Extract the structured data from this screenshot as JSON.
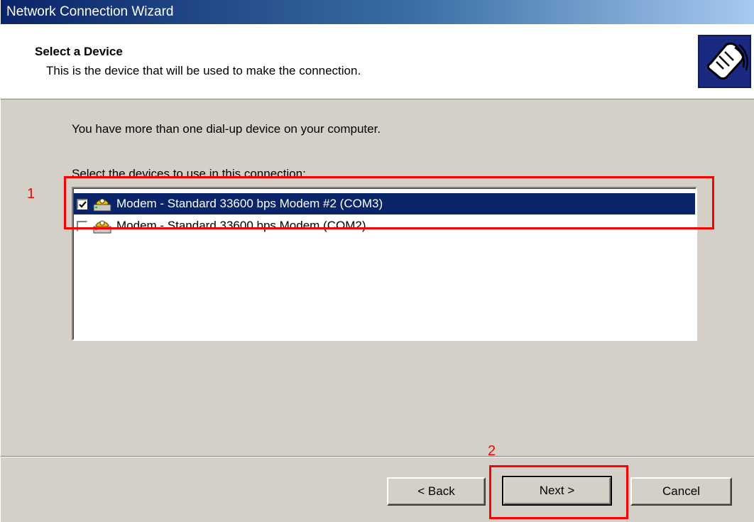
{
  "window": {
    "title": "Network Connection Wizard"
  },
  "header": {
    "title": "Select a Device",
    "subtitle": "This is the device that will be used to make the connection.",
    "icon": "phone-handset-icon"
  },
  "body": {
    "intro": "You have more than one dial-up device on your computer.",
    "list_label": "Select the devices to use in this connection:",
    "devices": [
      {
        "label": "Modem - Standard 33600 bps Modem #2 (COM3)",
        "checked": true,
        "selected": true,
        "icon": "modem-icon"
      },
      {
        "label": "Modem - Standard 33600 bps Modem (COM2)",
        "checked": false,
        "selected": false,
        "icon": "modem-icon"
      }
    ]
  },
  "buttons": {
    "back": "< Back",
    "next": "Next >",
    "cancel": "Cancel"
  },
  "annotations": {
    "marker_1": "1",
    "marker_2": "2",
    "color": "#ff0000"
  },
  "colors": {
    "selection": "#0a246a",
    "face": "#d4d0c8"
  }
}
